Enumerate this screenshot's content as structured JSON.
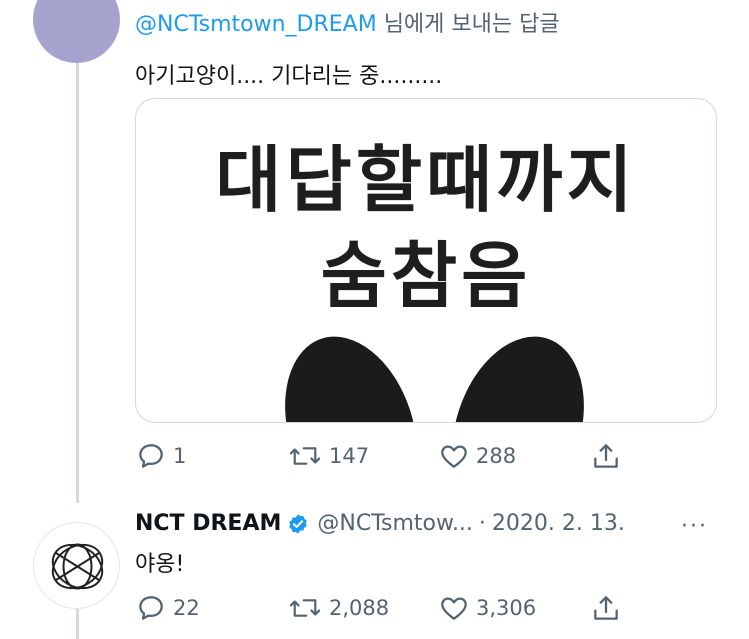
{
  "tweet1": {
    "reply_handle": "@NCTsmtown_DREAM",
    "reply_suffix": " 님에게 보내는 답글",
    "text": "아기고양이.... 기다리는 중.........",
    "media": {
      "line1": "대답할때까지",
      "line2": "숨참음"
    },
    "actions": {
      "replies": "1",
      "retweets": "147",
      "likes": "288"
    }
  },
  "tweet2": {
    "name": "NCT DREAM",
    "handle": "@NCTsmtow...",
    "separator": "·",
    "date": "2020. 2. 13.",
    "more": "···",
    "text": "야옹!",
    "actions": {
      "replies": "22",
      "retweets": "2,088",
      "likes": "3,306"
    }
  },
  "icons": [
    "reply-icon",
    "retweet-icon",
    "like-icon",
    "share-icon",
    "verified-icon",
    "more-icon"
  ],
  "colors": {
    "accent": "#1d9bf0",
    "muted": "#536471",
    "text": "#0f1419",
    "avatar1": "#a7a3cf",
    "thread_line": "#cfd9de"
  }
}
